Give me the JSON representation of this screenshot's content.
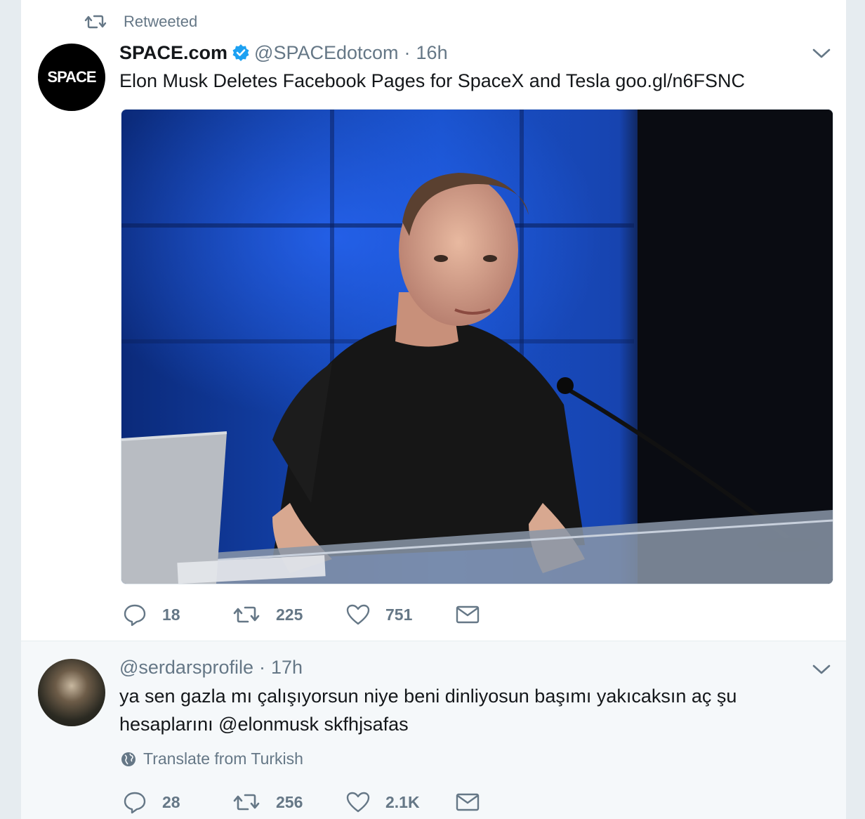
{
  "colors": {
    "secondary_text": "#657786",
    "verified_blue": "#1da1f2",
    "feed_background": "#e6ecf0",
    "reply_background": "#f5f8fa"
  },
  "tweet1": {
    "retweet_label": "Retweeted",
    "avatar_logo": "SPACE",
    "name": "SPACE.com",
    "verified": true,
    "handle": "@SPACEdotcom",
    "separator": "·",
    "time": "16h",
    "text": "Elon Musk Deletes Facebook Pages for SpaceX and Tesla goo.gl/n6FSNC",
    "media_description_icon": "photo",
    "actions": {
      "reply_count": "18",
      "retweet_count": "225",
      "like_count": "751"
    }
  },
  "tweet2": {
    "handle": "@serdarsprofile",
    "separator": "·",
    "time": "17h",
    "text": "ya sen gazla mı çalışıyorsun niye beni dinliyosun başımı yakıcaksın aç şu hesaplarını @elonmusk skfhjsafas",
    "translate_label": "Translate from Turkish",
    "actions": {
      "reply_count": "28",
      "retweet_count": "256",
      "like_count": "2.1K"
    }
  }
}
